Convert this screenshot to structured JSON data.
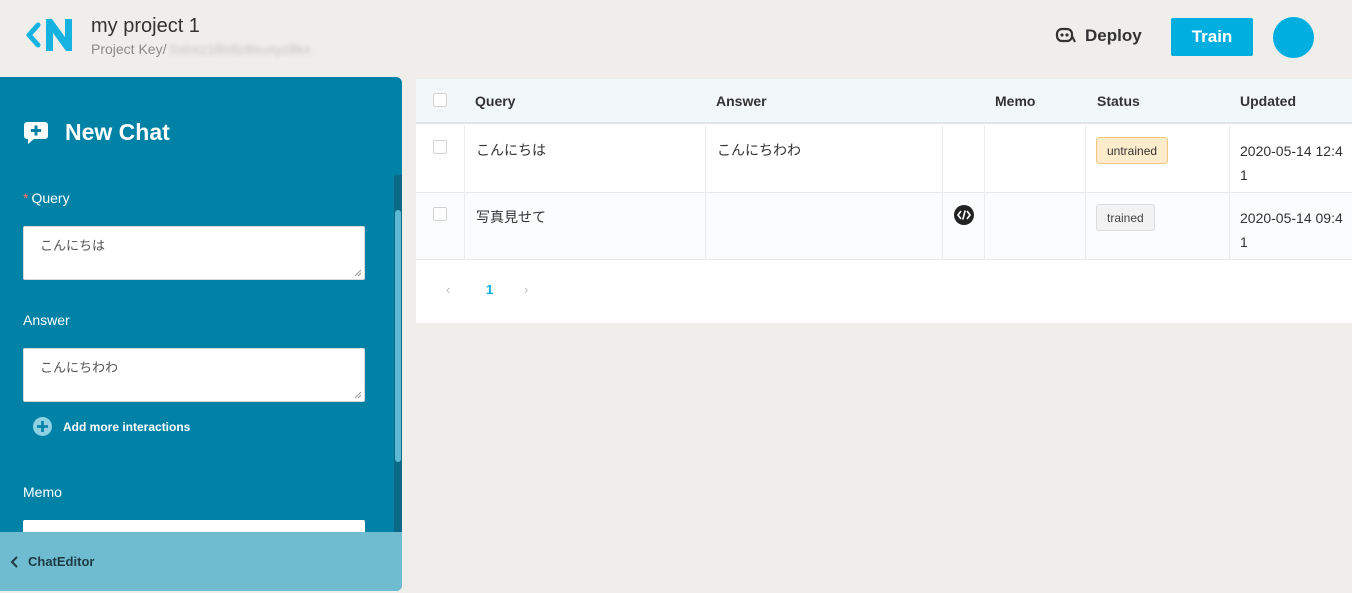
{
  "header": {
    "project_title": "my project 1",
    "project_key_label": "Project Key/",
    "project_key_value": "Sxhxz1lllx8z8xuxyz8kx",
    "deploy_label": "Deploy",
    "train_label": "Train"
  },
  "panel": {
    "title": "New Chat",
    "query_required_mark": "*",
    "query_label": "Query",
    "query_value": "こんにちは",
    "answer_label": "Answer",
    "answer_value": "こんにちわわ",
    "add_more_label": "Add more interactions",
    "memo_label": "Memo",
    "footer_label": "ChatEditor"
  },
  "table": {
    "headers": {
      "query": "Query",
      "answer": "Answer",
      "memo": "Memo",
      "status": "Status",
      "updated": "Updated"
    },
    "rows": [
      {
        "query": "こんにちは",
        "answer": "こんにちわわ",
        "memo": "",
        "status": "untrained",
        "updated": "2020-05-14 12:41"
      },
      {
        "query": "写真見せて",
        "answer": "",
        "memo": "",
        "status": "trained",
        "updated": "2020-05-14 09:41"
      }
    ],
    "pagination": {
      "prev": "‹",
      "current": "1",
      "next": "›"
    }
  },
  "colors": {
    "accent": "#00aee0",
    "panel": "#0081a6",
    "panel_footer": "#6fbbd0"
  }
}
